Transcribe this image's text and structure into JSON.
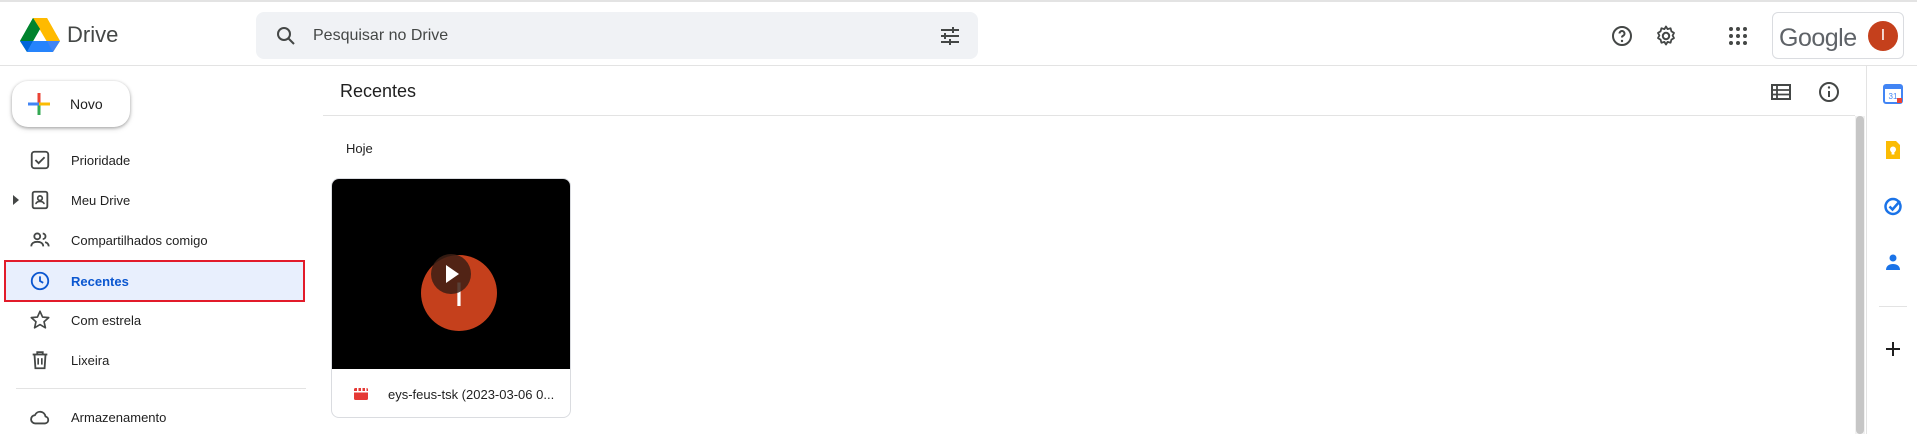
{
  "header": {
    "app_name": "Drive",
    "search_placeholder": "Pesquisar no Drive",
    "account_brand": "Google",
    "avatar_initial": "I"
  },
  "sidebar": {
    "new_button": "Novo",
    "items": [
      {
        "label": "Prioridade",
        "icon": "check-square-icon"
      },
      {
        "label": "Meu Drive",
        "icon": "my-drive-icon",
        "expandable": true
      },
      {
        "label": "Compartilhados comigo",
        "icon": "people-icon"
      },
      {
        "label": "Recentes",
        "icon": "clock-icon",
        "active": true
      },
      {
        "label": "Com estrela",
        "icon": "star-icon"
      },
      {
        "label": "Lixeira",
        "icon": "trash-icon"
      }
    ],
    "storage_label": "Armazenamento"
  },
  "main": {
    "title": "Recentes",
    "section": "Hoje",
    "files": [
      {
        "name": "eys-feus-tsk (2023-03-06 0...",
        "type_icon": "video-file-icon",
        "thumb_letter": "I"
      }
    ]
  },
  "right_rail": {
    "calendar_label": "31"
  },
  "colors": {
    "active_bg": "#e8effd",
    "active_text": "#0b57d0",
    "highlight_border": "#e21b2a",
    "avatar": "#c5401c"
  }
}
